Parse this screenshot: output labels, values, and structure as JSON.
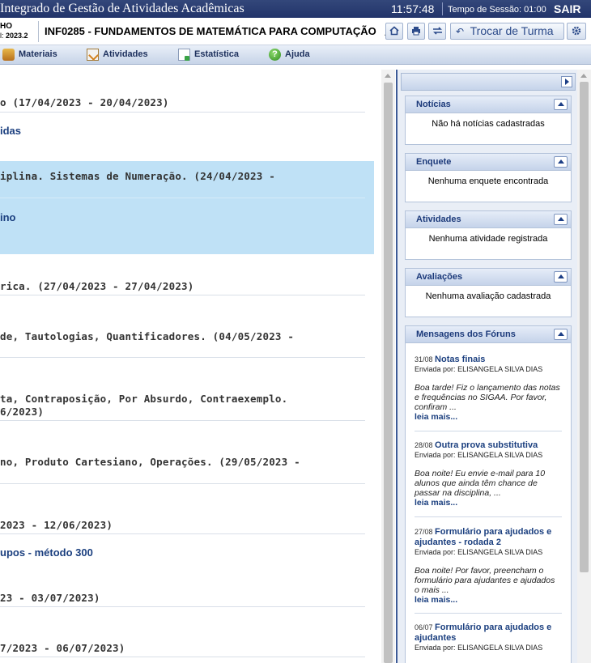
{
  "header": {
    "system_title": "Integrado de Gestão de Atividades Acadêmicas",
    "clock": "11:57:48",
    "session_label": "Tempo de Sessão: 01:00",
    "logout": "SAIR"
  },
  "course": {
    "name_fragment": "HO",
    "period_label": "l:",
    "period_value": "2023.2",
    "title": "INF0285 - FUNDAMENTOS DE MATEMÁTICA PARA COMPUTAÇÃO",
    "title_overflow": "A",
    "switch_class_label": "Trocar de Turma"
  },
  "menu": [
    "Materiais",
    "Atividades",
    "Estatística",
    "Ajuda"
  ],
  "topics": [
    {
      "title": "o (17/04/2023 - 20/04/2023)",
      "link": "idas"
    },
    {
      "title": "iplina. Sistemas de Numeração. (24/04/2023 -",
      "link": "ino"
    },
    {
      "title": "rica. (27/04/2023 - 27/04/2023)"
    },
    {
      "title": "de, Tautologias, Quantificadores. (04/05/2023 -"
    },
    {
      "title_line1": "ta, Contraposição, Por Absurdo, Contraexemplo.",
      "title_line2": "6/2023)"
    },
    {
      "title": "no, Produto Cartesiano, Operações. (29/05/2023 -"
    },
    {
      "title": "2023 - 12/06/2023)",
      "link": "upos - método 300"
    },
    {
      "title": "23 - 03/07/2023)"
    },
    {
      "title": "7/2023 - 06/07/2023)"
    }
  ],
  "sidebar": {
    "noticias": {
      "title": "Notícias",
      "text": "Não há notícias cadastradas"
    },
    "enquete": {
      "title": "Enquete",
      "text": "Nenhuma enquete encontrada"
    },
    "atividades": {
      "title": "Atividades",
      "text": "Nenhuma atividade registrada"
    },
    "avaliacoes": {
      "title": "Avaliações",
      "text": "Nenhuma avaliação cadastrada"
    },
    "foruns": {
      "title": "Mensagens dos Fóruns",
      "sent_by": "Enviada por:",
      "posts": [
        {
          "date": "31/08",
          "title": "Notas finais",
          "author": "ELISANGELA SILVA DIAS",
          "excerpt": "Boa tarde! Fiz o lançamento das notas e frequências no SIGAA. Por favor, confiram ...",
          "more": "leia mais..."
        },
        {
          "date": "28/08",
          "title": "Outra prova substitutiva",
          "author": "ELISANGELA SILVA DIAS",
          "excerpt": "Boa noite! Eu envie e-mail para 10 alunos que ainda têm chance de passar na disciplina, ...",
          "more": "leia mais..."
        },
        {
          "date": "27/08",
          "title": "Formulário para ajudados e ajudantes - rodada 2",
          "author": "ELISANGELA SILVA DIAS",
          "excerpt": "Boa noite!   Por favor, preencham o formulário para ajudantes e ajudados o mais ...",
          "more": "leia mais..."
        },
        {
          "date": "06/07",
          "title": "Formulário para ajudados e ajudantes",
          "author": "ELISANGELA SILVA DIAS"
        }
      ]
    }
  }
}
